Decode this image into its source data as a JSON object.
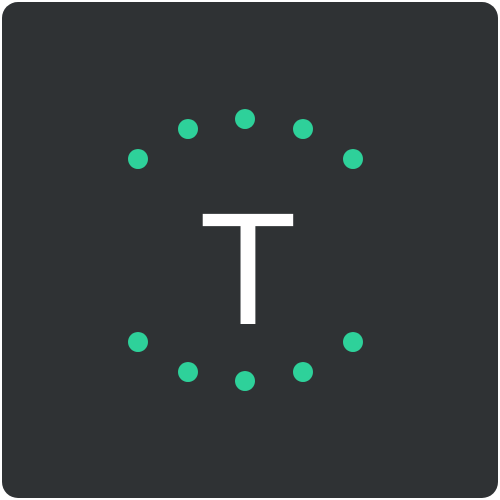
{
  "app_icon": {
    "letter": "T",
    "colors": {
      "background": "#2f3234",
      "letter": "#ffffff",
      "dots": "#2ed19a"
    },
    "dot_icon_names": [
      "dot-icon-upper-1",
      "dot-icon-upper-2",
      "dot-icon-upper-3",
      "dot-icon-upper-4",
      "dot-icon-upper-5",
      "dot-icon-lower-1",
      "dot-icon-lower-2",
      "dot-icon-lower-3",
      "dot-icon-lower-4",
      "dot-icon-lower-5"
    ]
  }
}
